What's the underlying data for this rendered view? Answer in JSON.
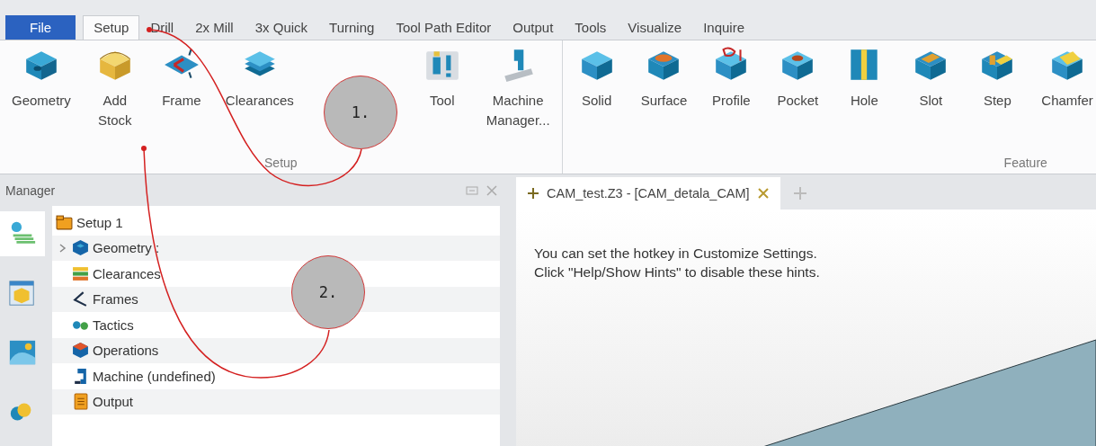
{
  "menu_tabs": [
    {
      "label": "File",
      "kind": "file",
      "selected": false
    },
    {
      "label": "Setup",
      "kind": "tab",
      "selected": true
    },
    {
      "label": "Drill",
      "kind": "tab",
      "selected": false
    },
    {
      "label": "2x Mill",
      "kind": "tab",
      "selected": false
    },
    {
      "label": "3x Quick",
      "kind": "tab",
      "selected": false
    },
    {
      "label": "Turning",
      "kind": "tab",
      "selected": false
    },
    {
      "label": "Tool Path Editor",
      "kind": "tab",
      "selected": false
    },
    {
      "label": "Output",
      "kind": "tab",
      "selected": false
    },
    {
      "label": "Tools",
      "kind": "tab",
      "selected": false
    },
    {
      "label": "Visualize",
      "kind": "tab",
      "selected": false
    },
    {
      "label": "Inquire",
      "kind": "tab",
      "selected": false
    }
  ],
  "ribbon_groups": [
    {
      "title": "Setup",
      "items": [
        {
          "label": "Geometry"
        },
        {
          "label": "Add\nStock"
        },
        {
          "label": "Frame"
        },
        {
          "label": "Clearances"
        },
        {
          "label": "Tool"
        },
        {
          "label": "Machine\nManager..."
        }
      ]
    },
    {
      "title": "Feature",
      "items": [
        {
          "label": "Solid"
        },
        {
          "label": "Surface"
        },
        {
          "label": "Profile"
        },
        {
          "label": "Pocket"
        },
        {
          "label": "Hole"
        },
        {
          "label": "Slot"
        },
        {
          "label": "Step"
        },
        {
          "label": "Chamfer"
        }
      ]
    }
  ],
  "manager": {
    "title": "Manager",
    "side_tabs": [
      {
        "selected": true
      },
      {
        "selected": false
      },
      {
        "selected": false
      },
      {
        "selected": false
      }
    ],
    "tree": [
      {
        "label": "Setup 1",
        "children": [
          {
            "label": "Geometry :",
            "expandable": true
          },
          {
            "label": "Clearances",
            "expandable": false
          },
          {
            "label": "Frames",
            "expandable": false
          },
          {
            "label": "Tactics",
            "expandable": false
          },
          {
            "label": "Operations",
            "expandable": false
          },
          {
            "label": "Machine (undefined)",
            "expandable": false
          },
          {
            "label": "Output",
            "expandable": false
          }
        ]
      }
    ]
  },
  "document_tab": {
    "title": "CAM_test.Z3 - [CAM_detala_CAM]"
  },
  "hints": [
    "You can set the hotkey in Customize Settings.",
    "Click \"Help/Show Hints\" to disable these hints."
  ],
  "callouts": [
    "1.",
    "2."
  ]
}
